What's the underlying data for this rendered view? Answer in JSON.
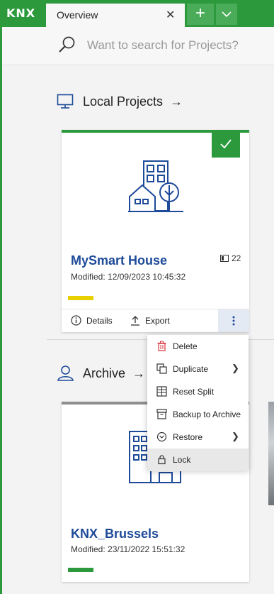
{
  "app": {
    "logo": "KNX"
  },
  "tabs": [
    {
      "label": "Overview",
      "close": "✕"
    }
  ],
  "tab_actions": {
    "add": "+",
    "dropdown": "chevron-down"
  },
  "search": {
    "placeholder": "Want to search for Projects?"
  },
  "sections": {
    "local": {
      "title": "Local Projects",
      "arrow": "→"
    },
    "archive": {
      "title": "Archive",
      "arrow": "→"
    }
  },
  "local_project": {
    "name": "MySmart House",
    "modified": "Modified: 12/09/2023 10:45:32",
    "device_count": "22",
    "status_color": "#e8cf00",
    "selected": true,
    "actions": {
      "details": "Details",
      "export": "Export"
    }
  },
  "archive_project": {
    "name": "KNX_Brussels",
    "modified": "Modified: 23/11/2022 15:51:32",
    "status_color": "#2c9a3c"
  },
  "context_menu": {
    "items": [
      {
        "label": "Delete",
        "icon": "trash-icon"
      },
      {
        "label": "Duplicate",
        "icon": "duplicate-icon",
        "submenu": true
      },
      {
        "label": "Reset Split",
        "icon": "reset-split-icon"
      },
      {
        "label": "Backup to Archive",
        "icon": "archive-icon"
      },
      {
        "label": "Restore",
        "icon": "restore-icon",
        "submenu": true
      },
      {
        "label": "Lock",
        "icon": "lock-icon",
        "hovered": true
      }
    ]
  },
  "colors": {
    "brand_green": "#2c9a3c",
    "accent_blue": "#1d4a99",
    "delete_red": "#d8333a"
  }
}
